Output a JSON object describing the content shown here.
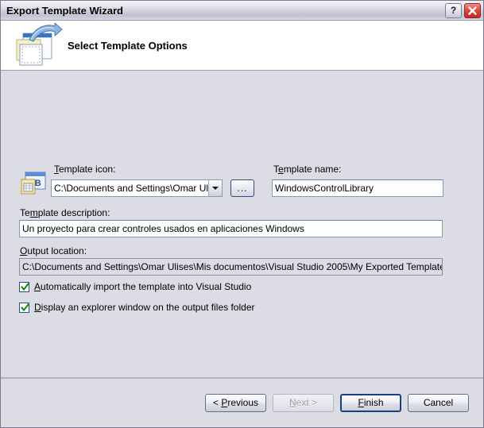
{
  "window": {
    "title": "Export Template Wizard",
    "help_button": "?",
    "close_button": "×"
  },
  "header": {
    "title": "Select Template Options",
    "icon": "export-template-icon"
  },
  "form": {
    "template_icon_label_pre": "T",
    "template_icon_label_accel": "",
    "template_icon_label": "Template icon:",
    "template_icon_value": "C:\\Documents and Settings\\Omar Ulises\\M",
    "project_icon": "visual-basic-project-icon",
    "browse_button_label": "...",
    "template_name_label": "Template name:",
    "template_name_value": "WindowsControlLibrary",
    "template_description_label": "Template  description:",
    "template_description_value": "Un proyecto para crear controles usados en aplicaciones Windows",
    "output_location_label": "Output location:",
    "output_location_value": "C:\\Documents and Settings\\Omar Ulises\\Mis documentos\\Visual Studio 2005\\My Exported Templates\\WindowsC",
    "checkbox_import_label": "Automatically import the template into Visual Studio",
    "checkbox_import_checked": true,
    "checkbox_explorer_label": "Display an explorer window on the output files folder",
    "checkbox_explorer_checked": true
  },
  "footer": {
    "previous_label": "< Previous",
    "next_label": "Next >",
    "finish_label": "Finish",
    "cancel_label": "Cancel"
  },
  "colors": {
    "dialog_background": "#dcdce4",
    "header_background": "#ffffff",
    "accent_border": "#19427c",
    "checkmark": "#108010",
    "close_button": "#c32822"
  }
}
